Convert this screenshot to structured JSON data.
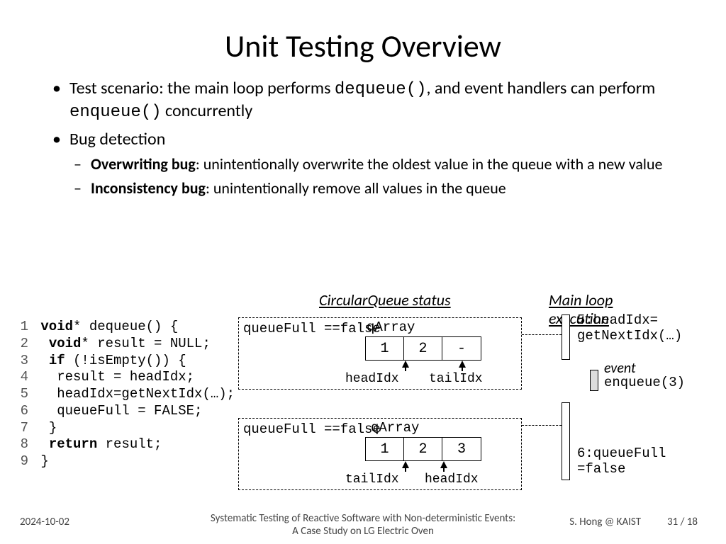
{
  "title": "Unit Testing Overview",
  "bullets": {
    "scenario_pre": "Test scenario: the main loop performs ",
    "scenario_code1": "dequeue()",
    "scenario_mid": ", and event handlers can perform ",
    "scenario_code2": "enqueue()",
    "scenario_post": " concurrently",
    "bugdetect": "Bug detection",
    "overwrite_head": "Overwriting bug",
    "overwrite_body": ": unintentionally overwrite the oldest value in the queue with a new value",
    "inconsist_head": "Inconsistency bug",
    "inconsist_body": ": unintentionally remove all values in the queue"
  },
  "code": {
    "l1a": "void",
    "l1b": "* dequeue() {",
    "l2a": "void",
    "l2b": "* result = NULL;",
    "l3a": "if",
    "l3b": " (!isEmpty()) {",
    "l4": "result = headIdx;",
    "l5": "headIdx=getNextIdx(…);",
    "l6": "queueFull = FALSE;",
    "l7": "}",
    "l8a": "return",
    "l8b": " result;",
    "l9": "}"
  },
  "labels": {
    "cq_status": "CircularQueue status",
    "main_loop": "Main loop",
    "execution": "execution",
    "qArray": "qArray",
    "queueFull_false": "queueFull ==false",
    "headIdx": "headIdx",
    "tailIdx": "tailIdx",
    "event": "event"
  },
  "cells1": [
    "1",
    "2",
    "-"
  ],
  "cells2": [
    "1",
    "2",
    "3"
  ],
  "exec": {
    "step5": "5:headIdx= getNextIdx(…)",
    "enqueue3": "enqueue(3)",
    "step6": "6:queueFull =false"
  },
  "footer": {
    "date": "2024-10-02",
    "center1": "Systematic Testing of Reactive Software with Non-deterministic Events:",
    "center2": "A Case Study on LG Electric Oven",
    "author": "S. Hong @ KAIST",
    "page": "31 / 18"
  }
}
